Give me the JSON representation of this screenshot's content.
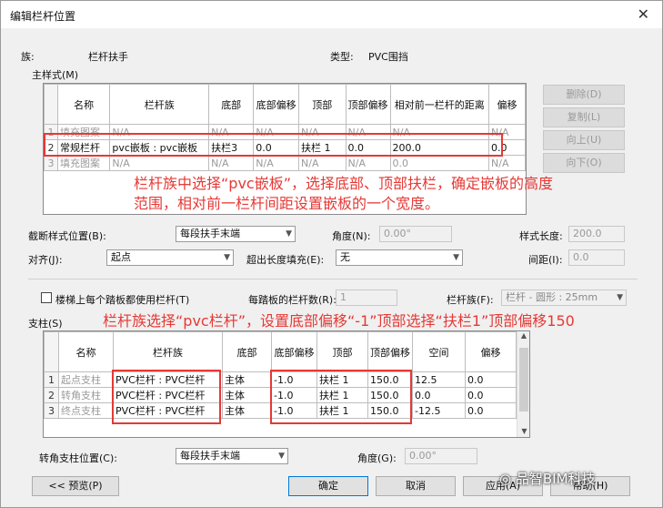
{
  "title": "编辑栏杆位置",
  "family_label": "族:",
  "family_value": "栏杆扶手",
  "type_label": "类型:",
  "type_value": "PVC围挡",
  "main_pattern": {
    "label": "主样式(M)",
    "headers": [
      "名称",
      "栏杆族",
      "底部",
      "底部偏移",
      "顶部",
      "顶部偏移",
      "相对前一栏杆的距离",
      "偏移"
    ],
    "rows": [
      {
        "n": "1",
        "name": "填充图案",
        "family": "N/A",
        "base": "N/A",
        "base_off": "N/A",
        "top": "N/A",
        "top_off": "N/A",
        "dist": "N/A",
        "offset": "N/A"
      },
      {
        "n": "2",
        "name": "常规栏杆",
        "family": "pvc嵌板 : pvc嵌板",
        "base": "扶栏3",
        "base_off": "0.0",
        "top": "扶栏 1",
        "top_off": "0.0",
        "dist": "200.0",
        "offset": "0.0"
      },
      {
        "n": "3",
        "name": "填充图案",
        "family": "N/A",
        "base": "N/A",
        "base_off": "N/A",
        "top": "N/A",
        "top_off": "N/A",
        "dist": "0.0",
        "offset": "N/A"
      }
    ],
    "buttons": {
      "delete": "删除(D)",
      "copy": "复制(L)",
      "up": "向上(U)",
      "down": "向下(O)"
    }
  },
  "annotation1": "栏杆族中选择“pvc嵌板”，选择底部、顶部扶栏，确定嵌板的高度范围，相对前一栏杆间距设置嵌板的一个宽度。",
  "break_pos": {
    "label": "截断样式位置(B):",
    "value": "每段扶手末端"
  },
  "angle1": {
    "label": "角度(N):",
    "value": "0.00°"
  },
  "pattern_len": {
    "label": "样式长度:",
    "value": "200.0"
  },
  "justify": {
    "label": "对齐(J):",
    "value": "起点"
  },
  "excess": {
    "label": "超出长度填充(E):",
    "value": "无"
  },
  "spacing": {
    "label": "间距(I):",
    "value": "0.0"
  },
  "per_tread": {
    "label": "楼梯上每个踏板都使用栏杆(T)"
  },
  "per_tread_count": {
    "label": "每踏板的栏杆数(R):",
    "value": "1"
  },
  "baluster_family": {
    "label": "栏杆族(F):",
    "value": "栏杆 - 圆形 : 25mm"
  },
  "posts": {
    "label": "支柱(S)",
    "headers": [
      "名称",
      "栏杆族",
      "底部",
      "底部偏移",
      "顶部",
      "顶部偏移",
      "空间",
      "偏移"
    ],
    "rows": [
      {
        "n": "1",
        "name": "起点支柱",
        "family": "PVC栏杆 : PVC栏杆",
        "base": "主体",
        "base_off": "-1.0",
        "top": "扶栏 1",
        "top_off": "150.0",
        "space": "12.5",
        "offset": "0.0"
      },
      {
        "n": "2",
        "name": "转角支柱",
        "family": "PVC栏杆 : PVC栏杆",
        "base": "主体",
        "base_off": "-1.0",
        "top": "扶栏 1",
        "top_off": "150.0",
        "space": "0.0",
        "offset": "0.0"
      },
      {
        "n": "3",
        "name": "终点支柱",
        "family": "PVC栏杆 : PVC栏杆",
        "base": "主体",
        "base_off": "-1.0",
        "top": "扶栏 1",
        "top_off": "150.0",
        "space": "-12.5",
        "offset": "0.0"
      }
    ]
  },
  "annotation2": "栏杆族选择“pvc栏杆”，设置底部偏移“-1”顶部选择“扶栏1”顶部偏移150",
  "corner_post": {
    "label": "转角支柱位置(C):",
    "value": "每段扶手末端"
  },
  "angle2": {
    "label": "角度(G):",
    "value": "0.00°"
  },
  "footer": {
    "preview": "<< 预览(P)",
    "ok": "确定",
    "cancel": "取消",
    "apply": "应用(A)",
    "help": "帮助(H)"
  },
  "watermark": "品智BIM科技"
}
